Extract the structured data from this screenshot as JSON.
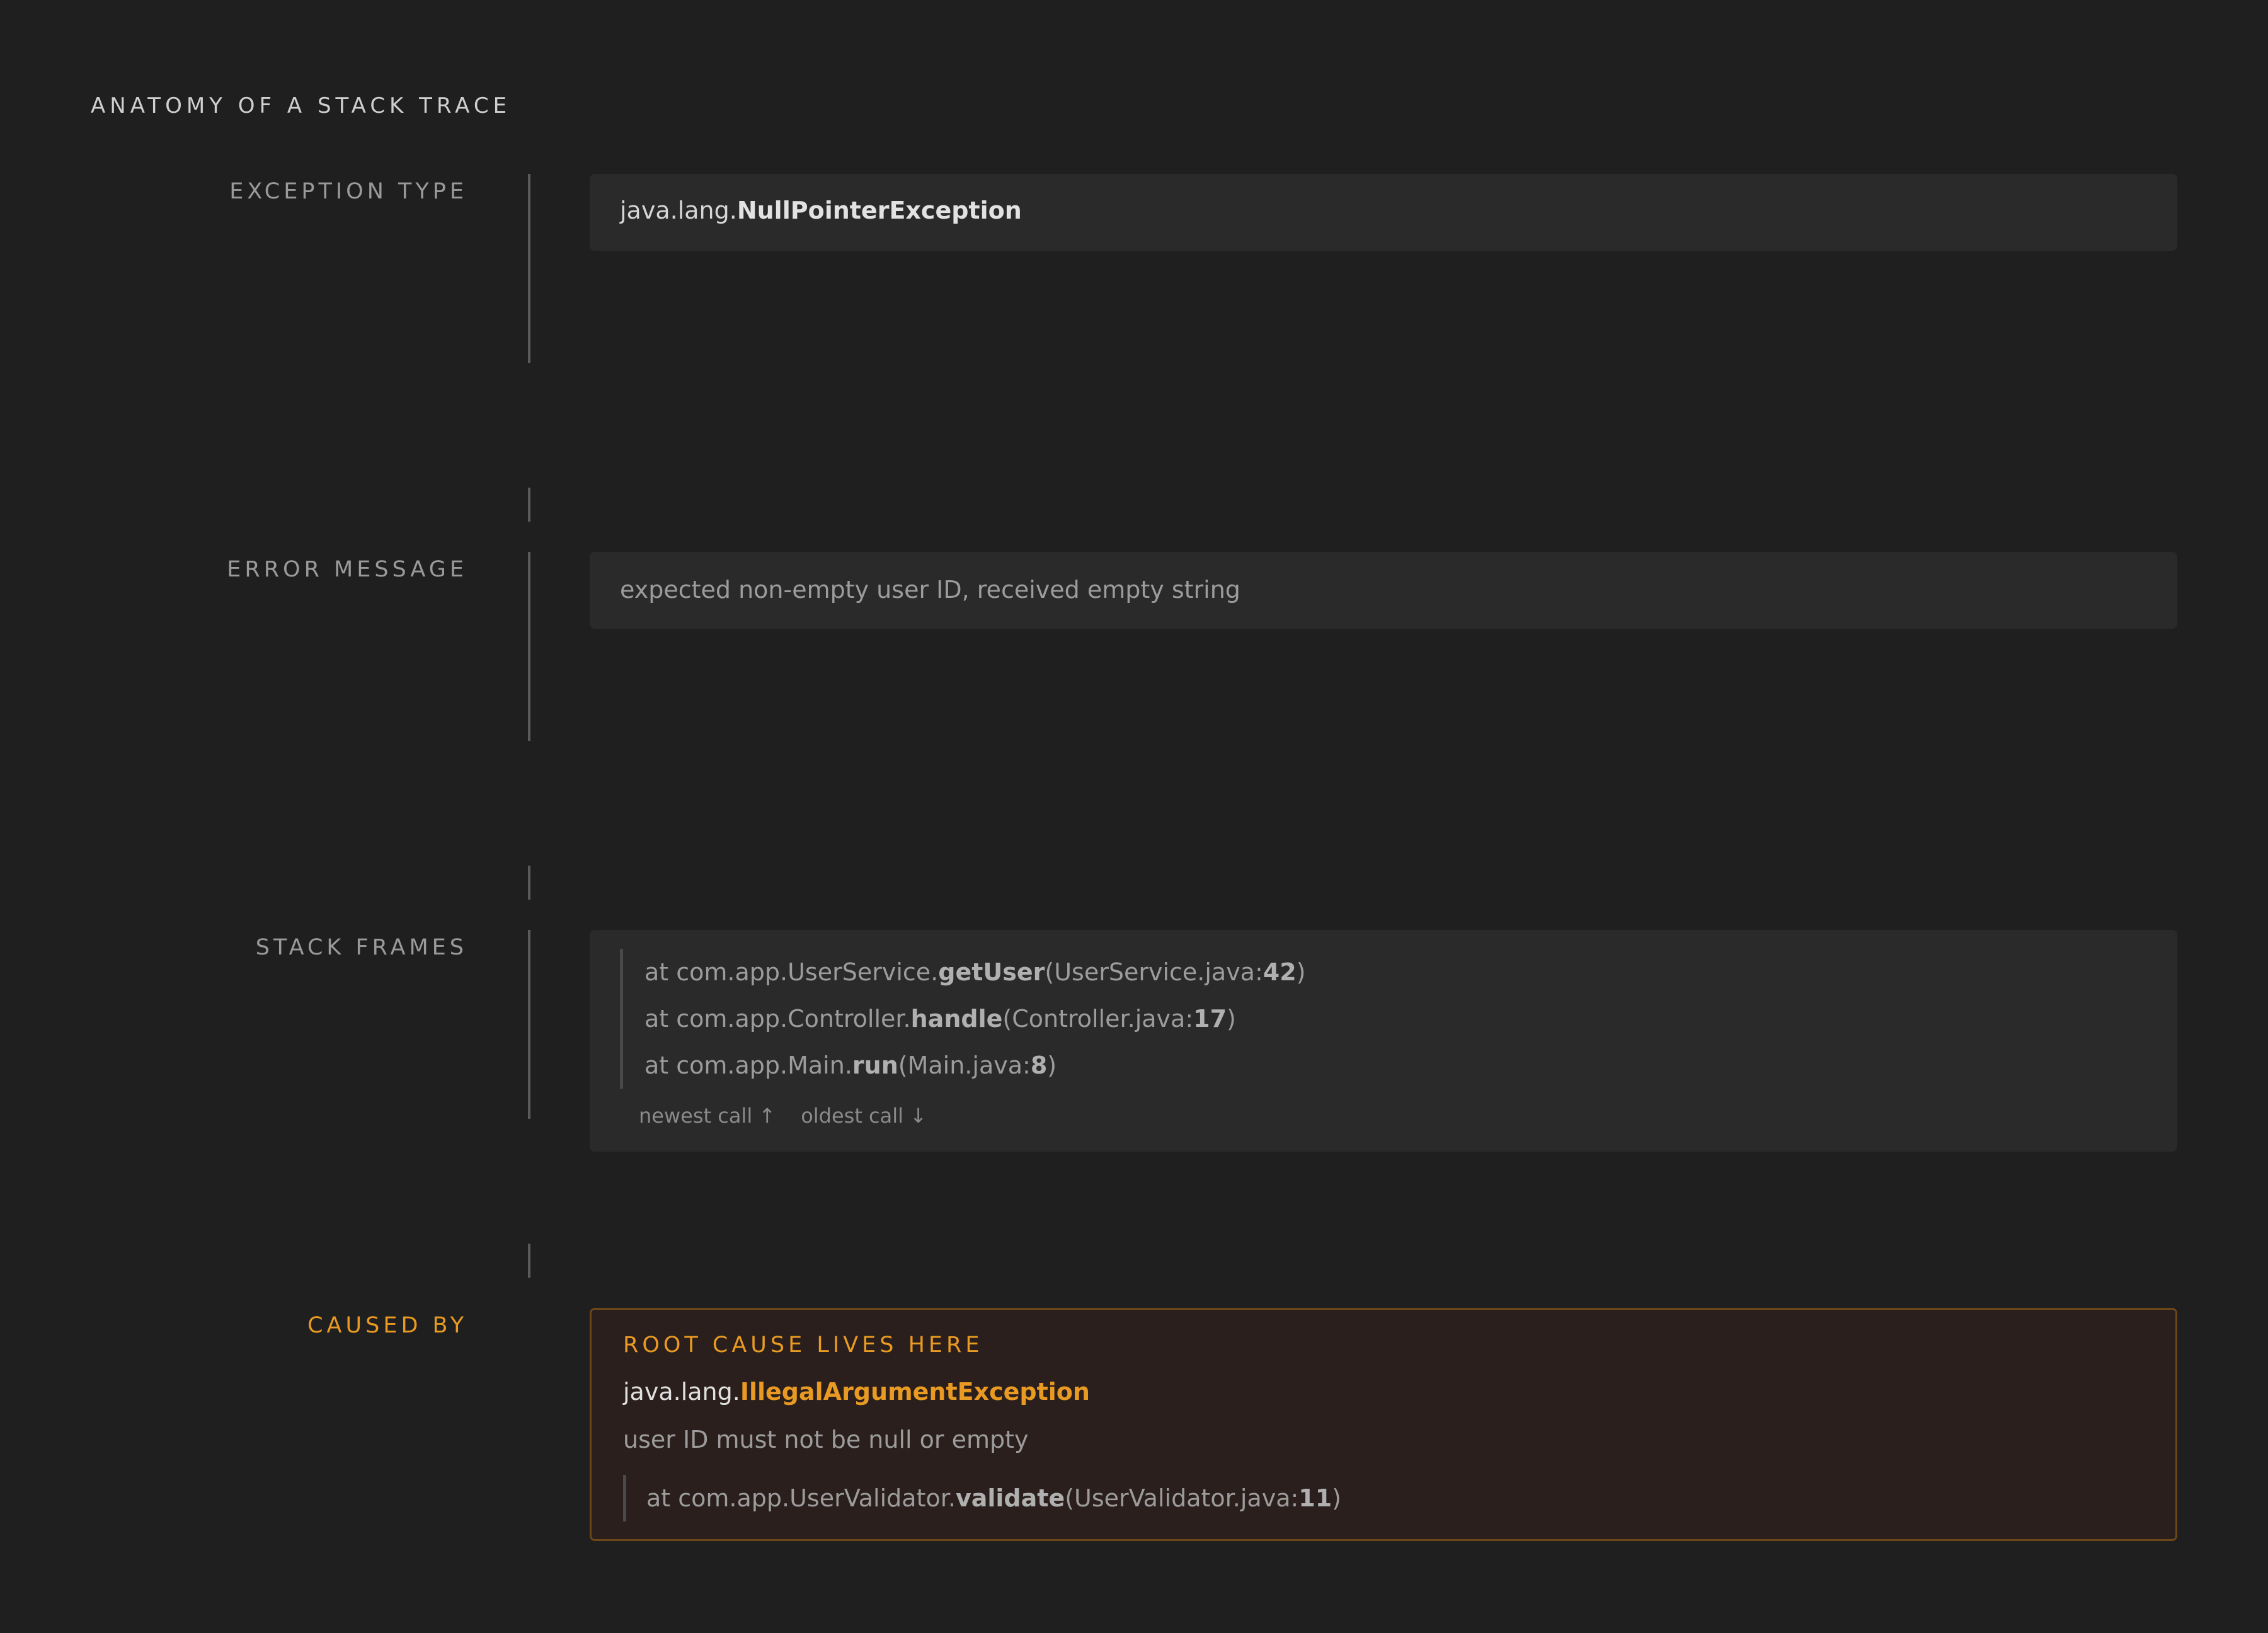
{
  "title": "ANATOMY OF A STACK TRACE",
  "sections": {
    "exception_type": {
      "label": "EXCEPTION TYPE",
      "package": "java.lang.",
      "class_name": "NullPointerException"
    },
    "error_message": {
      "label": "ERROR MESSAGE",
      "text": "expected non-empty user ID, received empty string"
    },
    "stack_frames": {
      "label": "STACK FRAMES",
      "frames": [
        {
          "prefix": "at com.app.UserService.",
          "method": "getUser",
          "file": "(UserService.java:",
          "line": "42",
          "close": ")"
        },
        {
          "prefix": "at com.app.Controller.",
          "method": "handle",
          "file": "(Controller.java:",
          "line": "17",
          "close": ")"
        },
        {
          "prefix": "at com.app.Main.",
          "method": "run",
          "file": "(Main.java:",
          "line": "8",
          "close": ")"
        }
      ],
      "hint_newest": "newest call ↑",
      "hint_oldest": "oldest call ↓"
    },
    "caused_by": {
      "label": "CAUSED BY",
      "heading": "ROOT CAUSE LIVES HERE",
      "package": "java.lang.",
      "class_name": "IllegalArgumentException",
      "message": "user ID must not be null or empty",
      "frame": {
        "prefix": "at com.app.UserValidator.",
        "method": "validate",
        "file": "(UserValidator.java:",
        "line": "11",
        "close": ")"
      }
    }
  },
  "colors": {
    "background": "#1f1f1f",
    "panel": "#2a2a2a",
    "accent": "#e89a22",
    "cause_panel": "#2a1f1c"
  }
}
